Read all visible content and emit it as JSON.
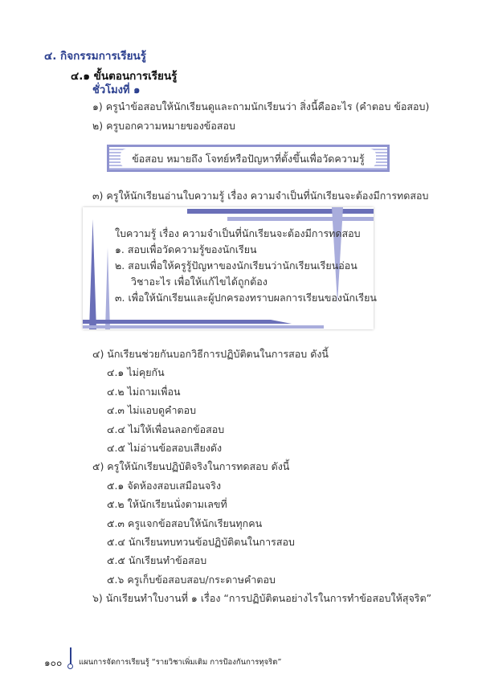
{
  "section": {
    "title": "๔. กิจกรรมการเรียนรู้",
    "subtitle": "๔.๑ ขั้นตอนการเรียนรู้",
    "hour": "ชั่วโมงที่ ๑"
  },
  "steps_top": [
    "๑) ครูนำข้อสอบให้นักเรียนดูและถามนักเรียนว่า สิ่งนี้คืออะไร (คำตอบ ข้อสอบ)",
    "๒) ครูบอกความหมายของข้อสอบ"
  ],
  "definition_box": "ข้อสอบ หมายถึง โจทย์หรือปัญหาที่ตั้งขึ้นเพื่อวัดความรู้",
  "step3": "๓) ครูให้นักเรียนอ่านใบความรู้ เรื่อง ความจำเป็นที่นักเรียนจะต้องมีการทดสอบ",
  "knowledge_sheet": {
    "title": "ใบความรู้ เรื่อง ความจำเป็นที่นักเรียนจะต้องมีการทดสอบ",
    "items": [
      "๑.  สอบเพื่อวัดความรู้ของนักเรียน",
      "๒.  สอบเพื่อให้ครูรู้ปัญหาของนักเรียนว่านักเรียนเรียนอ่อน",
      "วิชาอะไร เพื่อให้แก้ไขได้ถูกต้อง",
      "๓.  เพื่อให้นักเรียนและผู้ปกครองทราบผลการเรียนของนักเรียน"
    ]
  },
  "steps_bottom": [
    {
      "text": "๔) นักเรียนช่วยกันบอกวิธีการปฏิบัติตนในการสอบ ดังนี้",
      "level": 1
    },
    {
      "text": "๔.๑ ไม่คุยกัน",
      "level": 2
    },
    {
      "text": "๔.๒ ไม่ถามเพื่อน",
      "level": 2
    },
    {
      "text": "๔.๓ ไม่แอบดูคำตอบ",
      "level": 2
    },
    {
      "text": "๔.๔ ไม่ให้เพื่อนลอกข้อสอบ",
      "level": 2
    },
    {
      "text": "๔.๕ ไม่อ่านข้อสอบเสียงดัง",
      "level": 2
    },
    {
      "text": "๕) ครูให้นักเรียนปฏิบัติจริงในการทดสอบ ดังนี้",
      "level": 1
    },
    {
      "text": "๕.๑ จัดห้องสอบเสมือนจริง",
      "level": 2
    },
    {
      "text": "๕.๒ ให้นักเรียนนั่งตามเลขที่",
      "level": 2
    },
    {
      "text": "๕.๓ ครูแจกข้อสอบให้นักเรียนทุกคน",
      "level": 2
    },
    {
      "text": "๕.๔ นักเรียนทบทวนข้อปฏิบัติตนในการสอบ",
      "level": 2
    },
    {
      "text": "๕.๕ นักเรียนทำข้อสอบ",
      "level": 2
    },
    {
      "text": "๕.๖ ครูเก็บข้อสอบสอบ/กระดาษคำตอบ",
      "level": 2
    },
    {
      "text": "๖) นักเรียนทำใบงานที่ ๑ เรื่อง “การปฏิบัติตนอย่างไรในการทำข้อสอบให้สุจริต”",
      "level": 1
    }
  ],
  "footer": {
    "page_number": "๑๐๐",
    "text": "แผนการจัดการเรียนรู้ “รายวิชาเพิ่มเติม การป้องกันการทุจริต”"
  },
  "colors": {
    "heading": "#2b3f8f",
    "frame": "#6a6fb8"
  }
}
